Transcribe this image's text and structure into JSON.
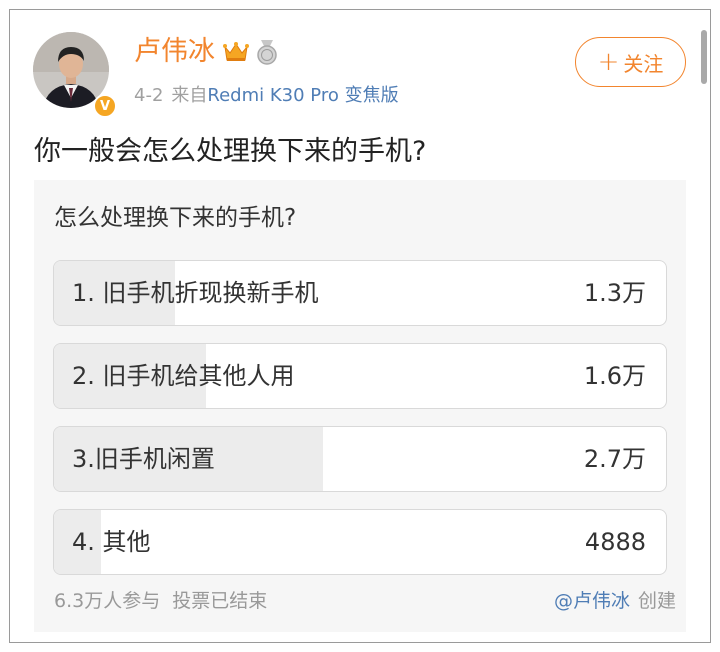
{
  "post": {
    "author": {
      "name": "卢伟冰",
      "verified_badge": "V"
    },
    "date": "4-2",
    "from_prefix": "来自",
    "device": "Redmi K30 Pro 变焦版",
    "follow_label": "关注",
    "text": "你一般会怎么处理换下来的手机?"
  },
  "poll": {
    "question": "怎么处理换下来的手机?",
    "options": [
      {
        "label": "1. 旧手机折现换新手机",
        "count": "1.3万",
        "share": 0.197
      },
      {
        "label": "2. 旧手机给其他人用",
        "count": "1.6万",
        "share": 0.248
      },
      {
        "label": "3.旧手机闲置",
        "count": "2.7万",
        "share": 0.44
      },
      {
        "label": "4. 其他",
        "count": "4888",
        "share": 0.077
      }
    ],
    "participants": "6.3万人参与",
    "status": "投票已结束",
    "creator": "@卢伟冰",
    "created_label": "创建"
  },
  "colors": {
    "name_orange": "#f2852e",
    "link_blue": "#4f7db5",
    "poll_bg": "#f6f6f6",
    "option_fill": "#ececec"
  },
  "icons": [
    "verified-icon",
    "crown-icon",
    "medal-icon",
    "plus-icon"
  ]
}
